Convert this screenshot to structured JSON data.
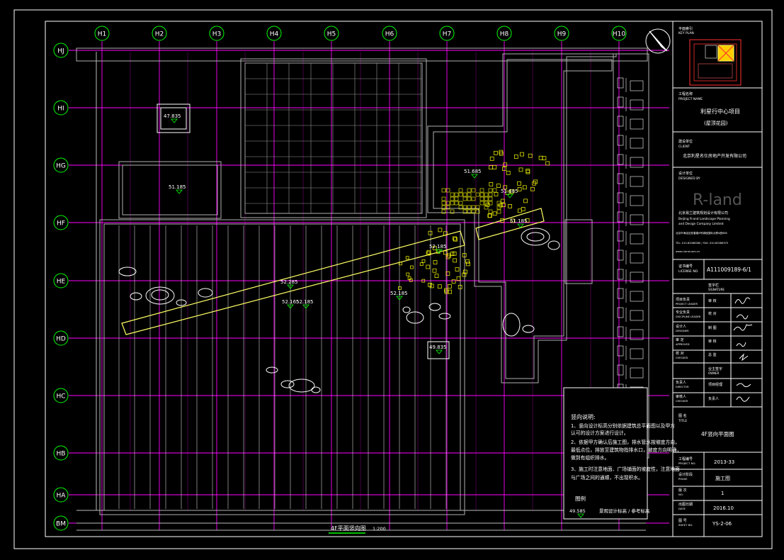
{
  "grid": {
    "columns": [
      "H1",
      "H2",
      "H3",
      "H4",
      "H5",
      "H6",
      "H7",
      "H8",
      "H9",
      "H10"
    ],
    "rows": [
      "HJ",
      "HI",
      "HG",
      "HF",
      "HE",
      "HD",
      "HC",
      "HB",
      "HA",
      "BM"
    ]
  },
  "elevations": {
    "e1": "47.835",
    "e2": "51.185",
    "e3": "51.685",
    "e4": "51.685",
    "e5": "51.185",
    "e6": "52.185",
    "e7": "52.285",
    "e8": "52.185",
    "e9": "52.165",
    "e10": "52.185",
    "e11": "49.835",
    "e12": "49.585"
  },
  "drawing_title": "4F平面竖向图",
  "drawing_scale": "1:200",
  "notes": {
    "title": "竖向说明:",
    "lines": [
      "1、竖向设计标高分别依据建筑总平面图以及甲方",
      "认可的设计方案进行设计。",
      "2、依据甲方确认后施工图，排水管水按坡度方向，",
      "最低点位，排放至建筑物指排水口，坡度方向明确，",
      "做到有组织排水。",
      "3、施工时注意地面、广场铺面的坡度性，注意地面",
      "与广场之间的通顺，不出现积水。"
    ],
    "legend_title": "图例",
    "legend_item": "景观设计标高 / 参考标高"
  },
  "title_block": {
    "keyplan_label": "平面索引",
    "keyplan_sub": "KEY PLAN",
    "project_label": "工程名称",
    "project_label_en": "PROJECT NAME",
    "project_name": "利星行中心项目",
    "project_sub": "(屋顶花园)",
    "owner_label": "建设单位",
    "owner_label_en": "CLIENT",
    "owner_name": "北京利星名仕房地产开发有限公司",
    "designer_label": "设计单位",
    "designer_label_en": "DESIGNED BY",
    "firm_logo": "R-land",
    "firm_cn": "北京易兰建筑规划设计有限公司",
    "firm_en1": "Beijing R-and Landscape Planning",
    "firm_en2": "and Design Company Limited",
    "firm_small1": "北京市海淀区知春路6号锦秋国际大厦A座608",
    "firm_small2": "TEL: 010-82086380 / FAX: 010-82086375",
    "firm_small3": "www.r-land.com.cn",
    "cert_label": "证书编号",
    "cert_label_en": "LICENSE NO.",
    "cert_no": "A111009189-6/1",
    "sign_header": "签字栏",
    "sign_header_en": "SIGNATURE",
    "r1_label": "项目负责",
    "r1_en": "PROJECT LEADER",
    "r1_role": "审 核",
    "r2_label": "专业负责",
    "r2_en": "DISCIPLINE LEADER",
    "r2_role": "校 对",
    "r3_label": "设计人",
    "r3_en": "DESIGNER",
    "r3_role": "制 图",
    "r4_label": "审 定",
    "r4_en": "APPROVED",
    "r4_role": "审 核",
    "r5_label": "校 对",
    "r5_en": "CHECKED",
    "r5_role": "总 监",
    "owner_sign_label": "业主签字",
    "owner_sign_en": "OWNER",
    "os1_label": "负责人",
    "os1_en": "DIRECTOR",
    "os1_role": "项目经理",
    "os2_label": "审核人",
    "os2_en": "CHECKER",
    "os2_role": "负责人",
    "title_label": "图 名",
    "title_label_en": "TITLE",
    "sheet_title": "4F竖向平面图",
    "projno_label": "工程编号",
    "projno_en": "PROJECT NO.",
    "projno": "2013-33",
    "phase_label": "设计阶段",
    "phase_en": "PHASE",
    "phase": "施工图",
    "ver_label": "版 次",
    "ver_en": "NO.",
    "ver": "1",
    "date_label": "出图日期",
    "date_en": "DATE",
    "date": "2016.10",
    "sheet_label": "图 号",
    "sheet_en": "SHEET NO.",
    "sheet_no": "YS-2-06"
  },
  "colors": {
    "grid": "#ff00ff",
    "bubble": "#00ff00",
    "lines": "#ffffff",
    "walls": "#a0a0a0",
    "highlight": "#ffff00"
  }
}
